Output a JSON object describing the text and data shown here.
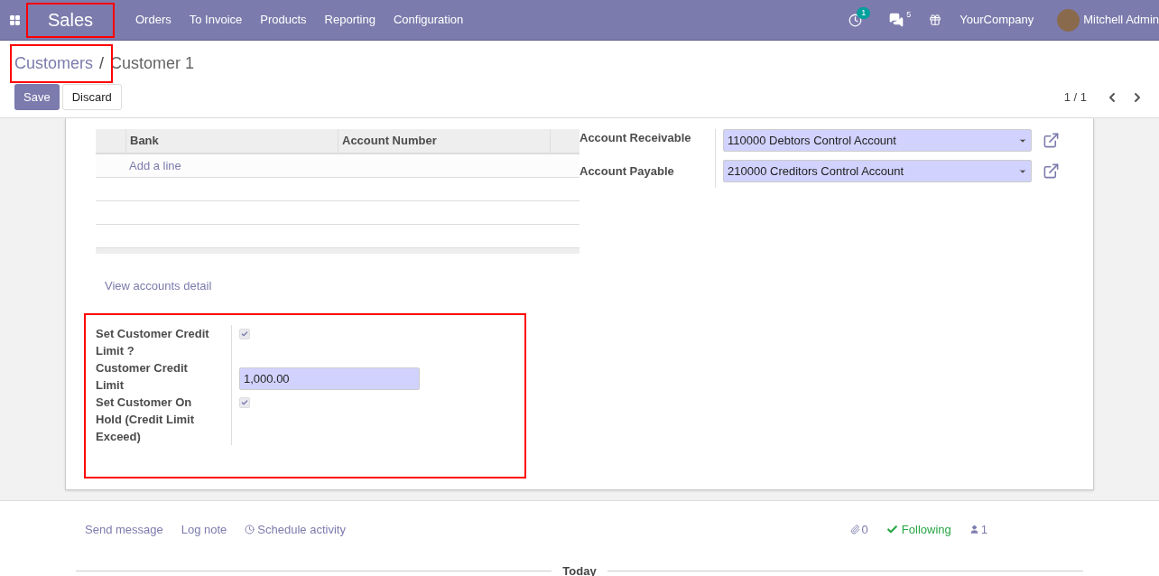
{
  "navbar": {
    "app_name": "Sales",
    "menu": [
      "Orders",
      "To Invoice",
      "Products",
      "Reporting",
      "Configuration"
    ],
    "activity_count": "1",
    "message_count": "5",
    "company": "YourCompany",
    "user": "Mitchell Admin"
  },
  "breadcrumb": {
    "parent": "Customers",
    "separator": "/",
    "current": "Customer 1"
  },
  "buttons": [
    "Save",
    "Discard"
  ],
  "pager": {
    "text": "1 / 1"
  },
  "bank_table": {
    "columns": [
      "Bank",
      "Account Number"
    ],
    "add_line": "Add a line"
  },
  "accounts": [
    {
      "label": "Account Receivable",
      "value": "110000 Debtors Control Account"
    },
    {
      "label": "Account Payable",
      "value": "210000 Creditors Control Account"
    }
  ],
  "view_accounts_link": "View accounts detail",
  "credit_fields": [
    {
      "kind": "checkbox",
      "label": "Set Customer Credit Limit ?",
      "checked": true
    },
    {
      "kind": "input",
      "label": "Customer Credit Limit",
      "value": "1,000.00"
    },
    {
      "kind": "checkbox",
      "label": "Set Customer On Hold (Credit Limit Exceed)",
      "checked": true
    }
  ],
  "chatter": {
    "actions": [
      "Send message",
      "Log note",
      "Schedule activity"
    ],
    "attachments": "0",
    "following": "Following",
    "followers": "1",
    "divider_label": "Today"
  }
}
